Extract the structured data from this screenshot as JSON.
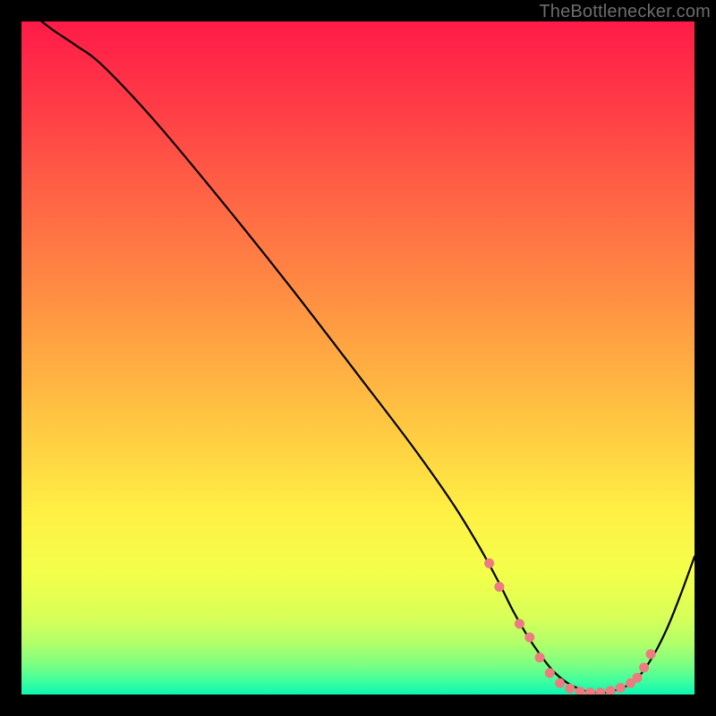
{
  "attribution": "TheBottlenecker.com",
  "chart_data": {
    "type": "line",
    "title": "",
    "xlabel": "",
    "ylabel": "",
    "xlim": [
      0,
      100
    ],
    "ylim": [
      0,
      100
    ],
    "series": [
      {
        "name": "curve",
        "stroke": "#000000",
        "stroke_width": 2.2,
        "x": [
          3,
          5,
          8,
          12,
          20,
          30,
          40,
          50,
          58,
          64,
          68,
          71,
          73,
          75,
          77,
          79,
          81,
          83,
          85,
          87,
          89,
          90.5,
          92,
          94,
          96,
          98,
          100
        ],
        "y": [
          100,
          98.5,
          96.5,
          93.5,
          85,
          73,
          60.5,
          47.5,
          37,
          28.5,
          22,
          16.5,
          12.5,
          9,
          6,
          3.5,
          1.8,
          0.8,
          0.3,
          0.3,
          0.9,
          1.6,
          3,
          6,
          10,
          15,
          20.5
        ]
      },
      {
        "name": "markers",
        "type": "scatter",
        "color": "#ed7b7f",
        "radius": 5.5,
        "x": [
          69.5,
          71,
          74,
          75.5,
          77,
          78.5,
          80,
          81.5,
          83,
          84.5,
          86,
          87.5,
          89,
          90.5,
          91.5,
          92.5,
          93.5
        ],
        "y": [
          19.5,
          16,
          10.5,
          8.5,
          5.5,
          3.2,
          1.7,
          0.9,
          0.45,
          0.3,
          0.3,
          0.55,
          1.0,
          1.7,
          2.5,
          4.0,
          6.0
        ]
      }
    ],
    "background_gradient": {
      "stops": [
        {
          "offset": 0.0,
          "color": "#ff1b48"
        },
        {
          "offset": 0.12,
          "color": "#ff3a46"
        },
        {
          "offset": 0.25,
          "color": "#ff6145"
        },
        {
          "offset": 0.38,
          "color": "#ff8643"
        },
        {
          "offset": 0.5,
          "color": "#ffaa42"
        },
        {
          "offset": 0.62,
          "color": "#ffce42"
        },
        {
          "offset": 0.73,
          "color": "#fff044"
        },
        {
          "offset": 0.82,
          "color": "#f3ff4a"
        },
        {
          "offset": 0.885,
          "color": "#d8ff58"
        },
        {
          "offset": 0.925,
          "color": "#b0ff6a"
        },
        {
          "offset": 0.955,
          "color": "#7dff82"
        },
        {
          "offset": 0.978,
          "color": "#44ff9c"
        },
        {
          "offset": 1.0,
          "color": "#0cf7b3"
        }
      ]
    }
  }
}
